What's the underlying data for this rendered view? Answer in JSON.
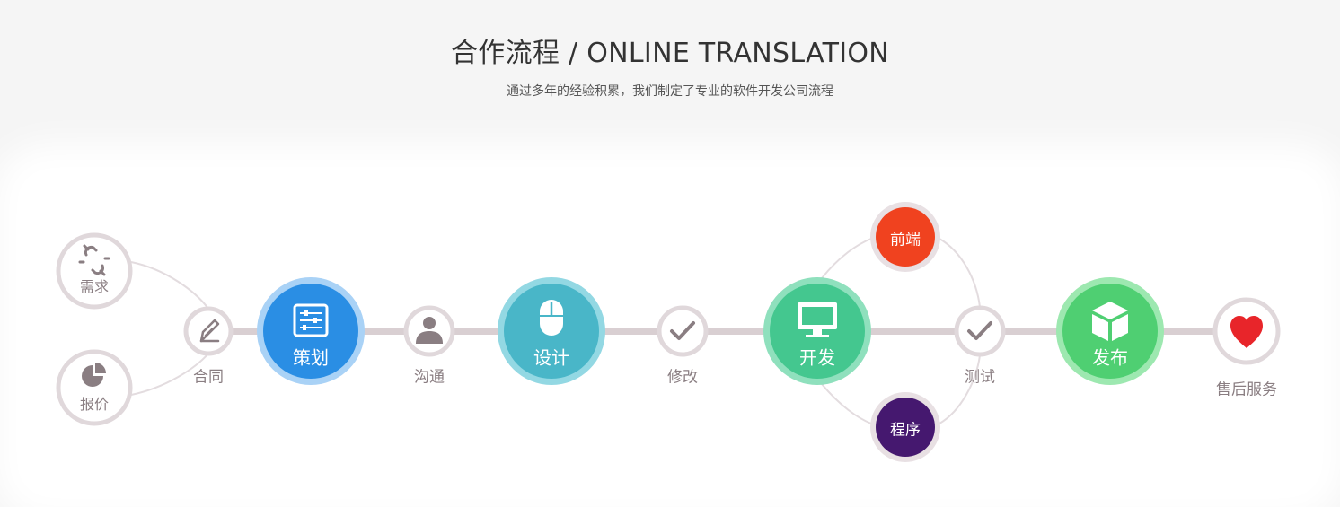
{
  "header": {
    "title": "合作流程 / ONLINE TRANSLATION",
    "subtitle": "通过多年的经验积累，我们制定了专业的软件开发公司流程"
  },
  "colors": {
    "line": "#d9cfd2",
    "small_ring": "#e0d8db",
    "icon_grey": "#8a7e82",
    "plan": "#2a8ee4",
    "plan_ring": "#a9d2f6",
    "design": "#49b6c8",
    "design_ring": "#93d8e3",
    "develop": "#44c78f",
    "develop_ring": "#8fe0bd",
    "release": "#4fcf72",
    "release_ring": "#9de8b0",
    "frontend": "#f0421f",
    "program": "#45186f",
    "heart": "#e8252a"
  },
  "nodes": {
    "requirement": {
      "label": "需求",
      "icon": "broken-link-icon"
    },
    "quote": {
      "label": "报价",
      "icon": "pie-chart-icon"
    },
    "contract": {
      "label": "合同",
      "icon": "pen-icon"
    },
    "plan": {
      "label": "策划",
      "icon": "sliders-icon"
    },
    "communicate": {
      "label": "沟通",
      "icon": "user-icon"
    },
    "design": {
      "label": "设计",
      "icon": "mouse-icon"
    },
    "revise": {
      "label": "修改",
      "icon": "check-icon"
    },
    "develop": {
      "label": "开发",
      "icon": "monitor-icon"
    },
    "frontend": {
      "label": "前端"
    },
    "program": {
      "label": "程序"
    },
    "test": {
      "label": "测试",
      "icon": "check-icon"
    },
    "release": {
      "label": "发布",
      "icon": "box-icon"
    },
    "aftersales": {
      "label": "售后服务",
      "icon": "heart-icon"
    }
  }
}
